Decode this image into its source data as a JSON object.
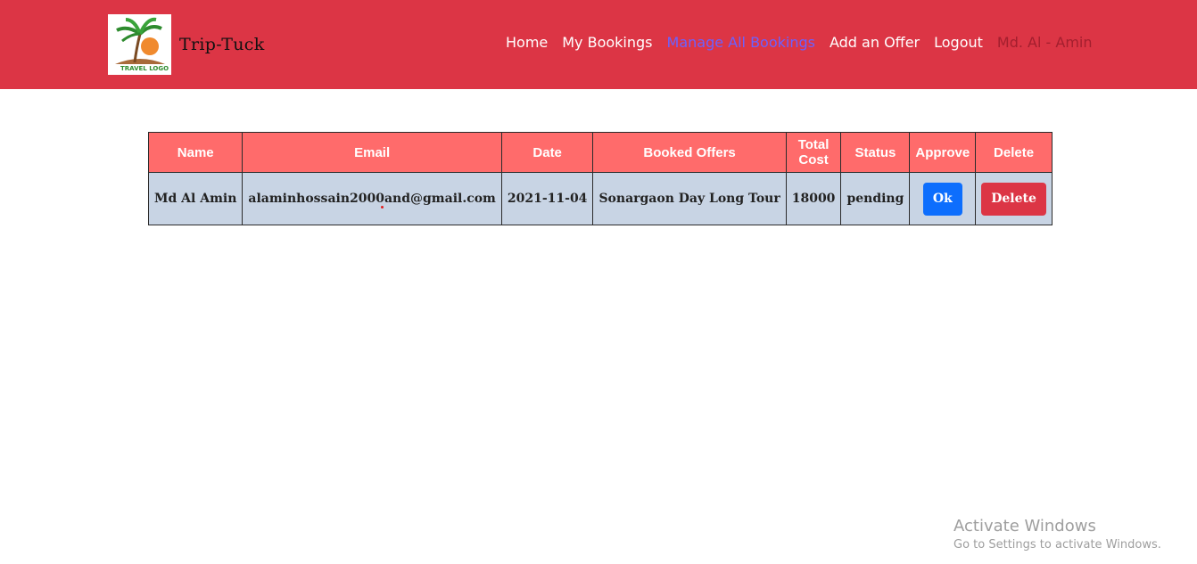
{
  "brand": {
    "name": "Trip-Tuck",
    "logo_text": "TRAVEL LOGO"
  },
  "nav": {
    "items": [
      {
        "label": "Home"
      },
      {
        "label": "My Bookings"
      },
      {
        "label": "Manage All Bookings"
      },
      {
        "label": "Add an Offer"
      },
      {
        "label": "Logout"
      }
    ],
    "user": "Md. Al - Amin"
  },
  "table": {
    "headers": [
      "Name",
      "Email",
      "Date",
      "Booked Offers",
      "Total Cost",
      "Status",
      "Approve",
      "Delete"
    ],
    "rows": [
      {
        "name": "Md Al Amin",
        "email": "alaminhossain2000and@gmail.com",
        "date": "2021-11-04",
        "offer": "Sonargaon Day Long Tour",
        "cost": "18000",
        "status": "pending",
        "approve_label": "Ok",
        "delete_label": "Delete"
      }
    ]
  },
  "watermark": {
    "title": "Activate Windows",
    "subtitle": "Go to Settings to activate Windows."
  },
  "colors": {
    "navbar": "#dc3545",
    "header_row": "#ff6b6b",
    "body_row": "#c8d4e4",
    "ok_button": "#0d6efd",
    "delete_button": "#dc3545",
    "active_link": "#6b61ff"
  }
}
